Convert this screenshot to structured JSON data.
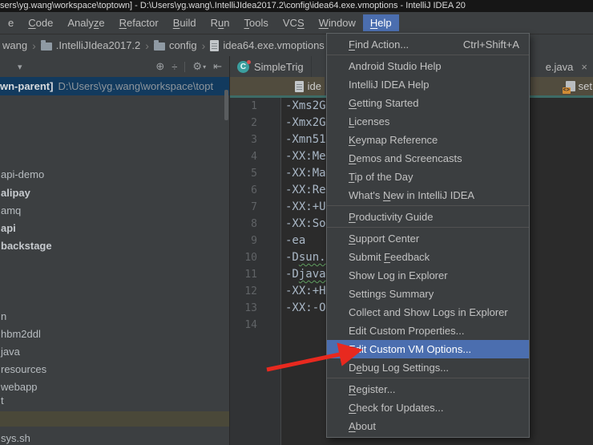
{
  "title_bar": {
    "text": "sers\\yg.wang\\workspace\\toptown] - D:\\Users\\yg.wang\\.IntelliJIdea2017.2\\config\\idea64.exe.vmoptions - IntelliJ IDEA 20"
  },
  "menu_bar": {
    "items": [
      {
        "label": "e"
      },
      {
        "label": "Code",
        "mnemonic": "C"
      },
      {
        "label": "Analyze",
        "mnemonic": "z"
      },
      {
        "label": "Refactor",
        "mnemonic": "R"
      },
      {
        "label": "Build",
        "mnemonic": "B"
      },
      {
        "label": "Run",
        "mnemonic": "u"
      },
      {
        "label": "Tools",
        "mnemonic": "T"
      },
      {
        "label": "VCS",
        "mnemonic": "S"
      },
      {
        "label": "Window",
        "mnemonic": "W"
      },
      {
        "label": "Help",
        "mnemonic": "H",
        "active": true
      }
    ]
  },
  "breadcrumbs": {
    "items": [
      {
        "label": "wang"
      },
      {
        "label": ".IntelliJIdea2017.2",
        "icon": "folder"
      },
      {
        "label": "config",
        "icon": "folder"
      },
      {
        "label": "idea64.exe.vmoptions",
        "icon": "file"
      }
    ]
  },
  "project_panel": {
    "caret_glyph": "▾",
    "toolbar_icons": [
      {
        "name": "locate-icon",
        "glyph": "⊕"
      },
      {
        "name": "collapse-all-icon",
        "glyph": "÷"
      },
      {
        "name": "divider",
        "glyph": ""
      },
      {
        "name": "gear-icon",
        "glyph": "⚙"
      },
      {
        "name": "hide-panel-icon",
        "glyph": "⇤"
      }
    ],
    "header_row": {
      "bold": "wn-parent]",
      "path": "D:\\Users\\yg.wang\\workspace\\topt"
    },
    "tree_items": [
      {
        "label": "api-demo",
        "bold": false
      },
      {
        "label": "alipay",
        "bold": true
      },
      {
        "label": "amq",
        "bold": false
      },
      {
        "label": "api",
        "bold": true
      },
      {
        "label": "backstage",
        "bold": true
      },
      {
        "label": "n",
        "bold": false
      },
      {
        "label": "hbm2ddl",
        "bold": false
      },
      {
        "label": "java",
        "bold": false
      },
      {
        "label": "resources",
        "bold": false
      },
      {
        "label": "webapp",
        "bold": false
      },
      {
        "label": "t",
        "bold": false
      },
      {
        "label": "sys.sh",
        "bold": false
      }
    ]
  },
  "editor": {
    "tabs_row1": {
      "left_tab": {
        "icon": "class",
        "label": "SimpleTrig"
      },
      "right_tab": {
        "label": "e.java",
        "close_glyph": "×"
      }
    },
    "tabs_row2": {
      "left_tab": {
        "icon": "file",
        "label": "ide"
      },
      "right_tab": {
        "icon": "code-file",
        "label": "set"
      }
    },
    "lines": [
      {
        "num": "1",
        "pre": "-Xms2G",
        "wavy": ""
      },
      {
        "num": "2",
        "pre": "-Xmx2G",
        "wavy": ""
      },
      {
        "num": "3",
        "pre": "-Xmn51",
        "wavy": ""
      },
      {
        "num": "4",
        "pre": "-XX:Me",
        "wavy": ""
      },
      {
        "num": "5",
        "pre": "-XX:Ma",
        "wavy": ""
      },
      {
        "num": "6",
        "pre": "-XX:Re",
        "wavy": ""
      },
      {
        "num": "7",
        "pre": "-XX:+U",
        "wavy": ""
      },
      {
        "num": "8",
        "pre": "-XX:So",
        "wavy": ""
      },
      {
        "num": "9",
        "pre": "-ea",
        "wavy": ""
      },
      {
        "num": "10",
        "pre": "-D",
        "wavy": "sun."
      },
      {
        "num": "11",
        "pre": "-D",
        "wavy": "java"
      },
      {
        "num": "12",
        "pre": "-XX:+H",
        "wavy": ""
      },
      {
        "num": "13",
        "pre": "-XX:-O",
        "wavy": ""
      },
      {
        "num": "14",
        "pre": "",
        "wavy": ""
      }
    ]
  },
  "help_menu": {
    "items": [
      {
        "label": "Find Action...",
        "mnemonic": "F",
        "shortcut": "Ctrl+Shift+A"
      },
      {
        "type": "separator"
      },
      {
        "label": "Android Studio Help"
      },
      {
        "label": "IntelliJ IDEA Help"
      },
      {
        "label": "Getting Started",
        "mnemonic": "G"
      },
      {
        "label": "Licenses",
        "mnemonic": "L"
      },
      {
        "label": "Keymap Reference",
        "mnemonic": "K"
      },
      {
        "label": "Demos and Screencasts",
        "mnemonic": "D"
      },
      {
        "label": "Tip of the Day",
        "mnemonic": "T"
      },
      {
        "label": "What's New in IntelliJ IDEA",
        "mnemonic": "N"
      },
      {
        "type": "separator"
      },
      {
        "label": "Productivity Guide",
        "mnemonic": "P"
      },
      {
        "type": "separator"
      },
      {
        "label": "Support Center",
        "mnemonic": "S"
      },
      {
        "label": "Submit Feedback",
        "mnemonic": "F"
      },
      {
        "label": "Show Log in Explorer"
      },
      {
        "label": "Settings Summary"
      },
      {
        "label": "Collect and Show Logs in Explorer"
      },
      {
        "label": "Edit Custom Properties..."
      },
      {
        "label": "Edit Custom VM Options...",
        "highlighted": true
      },
      {
        "label": "Debug Log Settings...",
        "mnemonic": "e"
      },
      {
        "type": "separator"
      },
      {
        "label": "Register...",
        "mnemonic": "R"
      },
      {
        "label": "Check for Updates...",
        "mnemonic": "C"
      },
      {
        "label": "About",
        "mnemonic": "A"
      }
    ]
  },
  "colors": {
    "accent_blue": "#4b6eaf",
    "tab_active_bg": "#514c3e",
    "tab_underline": "#3d6b66",
    "header_selected_bg": "#123a5e",
    "arrow_red": "#e8291f"
  }
}
